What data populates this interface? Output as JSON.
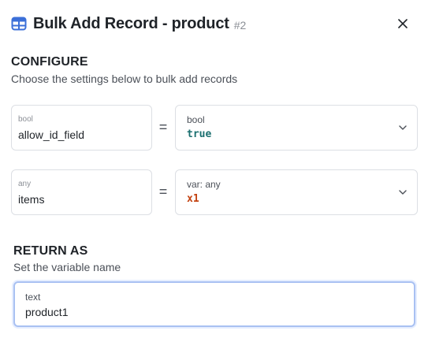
{
  "header": {
    "title": "Bulk Add Record - product",
    "id_label": "#2",
    "icon": "table-icon",
    "close_icon": "close-icon"
  },
  "configure": {
    "title": "CONFIGURE",
    "subtitle": "Choose the settings below to bulk add records",
    "rows": [
      {
        "param_type": "bool",
        "param_name": "allow_id_field",
        "operator": "=",
        "value_type": "bool",
        "value": "true",
        "value_color": "#1a6f6f"
      },
      {
        "param_type": "any",
        "param_name": "items",
        "operator": "=",
        "value_type": "var: any",
        "value": "x1",
        "value_color": "#c3410f"
      }
    ]
  },
  "return_as": {
    "title": "RETURN AS",
    "subtitle": "Set the variable name",
    "field_type": "text",
    "value": "product1"
  },
  "colors": {
    "accent": "#3b6fd8",
    "focus_border": "#a9c1f2"
  }
}
